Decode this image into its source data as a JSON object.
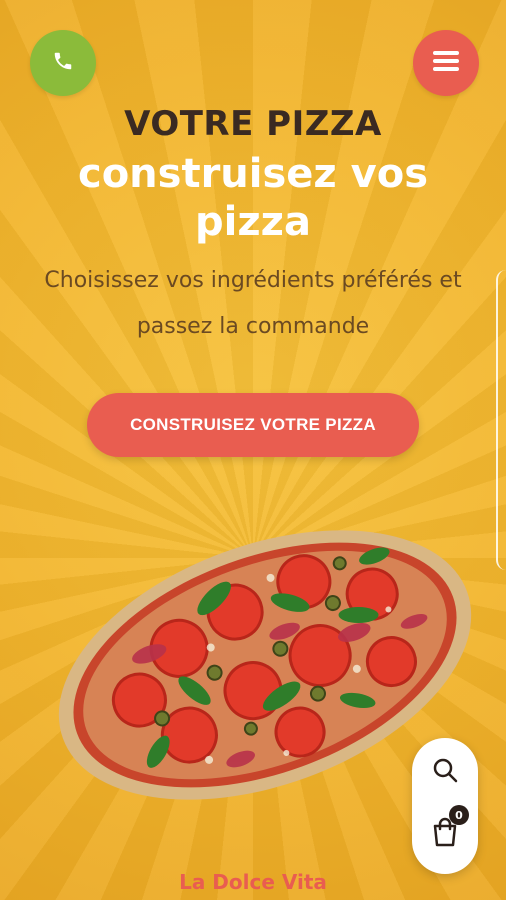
{
  "header": {
    "phone_icon": "phone-icon",
    "menu_icon": "hamburger-menu-icon"
  },
  "hero": {
    "eyebrow": "VOTRE PIZZA",
    "headline": "construisez vos pizza",
    "subtitle": "Choisissez vos ingrédients préférés et passez la commande",
    "cta_label": "CONSTRUISEZ VOTRE PIZZA"
  },
  "floating": {
    "search_icon": "search-icon",
    "cart_icon": "shopping-bag-icon",
    "cart_count": "0"
  },
  "footer": {
    "brand": "La Dolce Vita"
  },
  "colors": {
    "background": "#f2b52c",
    "phone_button": "#8bbb3a",
    "accent": "#e95d50",
    "heading_dark": "#3a2a22",
    "subtitle_text": "#6b4a22"
  }
}
